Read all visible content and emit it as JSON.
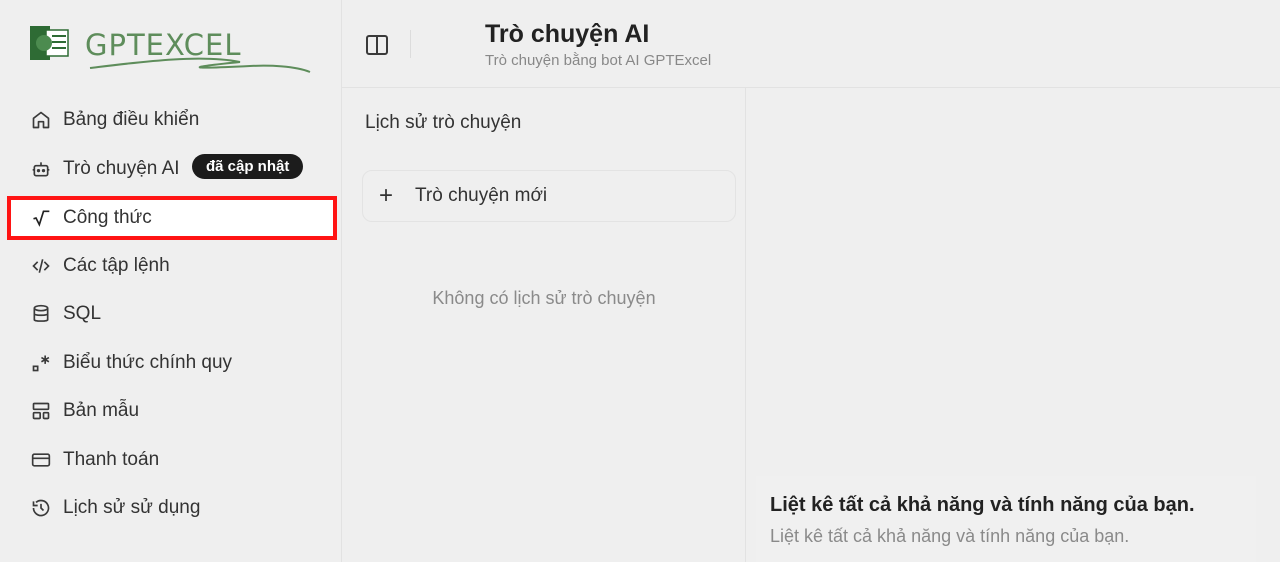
{
  "brand": {
    "logo_text": "GPTEXCEL",
    "accent": "#5e8d5b"
  },
  "sidebar": {
    "items": [
      {
        "label": "Bảng điều khiển",
        "icon": "home-icon"
      },
      {
        "label": "Trò chuyện AI",
        "icon": "bot-icon",
        "badge": "đã cập nhật"
      },
      {
        "label": "Công thức",
        "icon": "sqrt-icon",
        "highlighted": true
      },
      {
        "label": "Các tập lệnh",
        "icon": "code-icon"
      },
      {
        "label": "SQL",
        "icon": "database-icon"
      },
      {
        "label": "Biểu thức chính quy",
        "icon": "regex-icon"
      },
      {
        "label": "Bản mẫu",
        "icon": "template-icon"
      },
      {
        "label": "Thanh toán",
        "icon": "credit-card-icon"
      },
      {
        "label": "Lịch sử sử dụng",
        "icon": "history-icon"
      }
    ],
    "highlight_color": "#ff1414"
  },
  "header": {
    "title": "Trò chuyện AI",
    "subtitle": "Trò chuyện bằng bot AI GPTExcel"
  },
  "history": {
    "title": "Lịch sử trò chuyện",
    "new_chat_label": "Trò chuyện mới",
    "empty_text": "Không có lịch sử trò chuyện"
  },
  "main": {
    "card_title": "Liệt kê tất cả khả năng và tính năng của bạn.",
    "card_desc": "Liệt kê tất cả khả năng và tính năng của bạn."
  }
}
